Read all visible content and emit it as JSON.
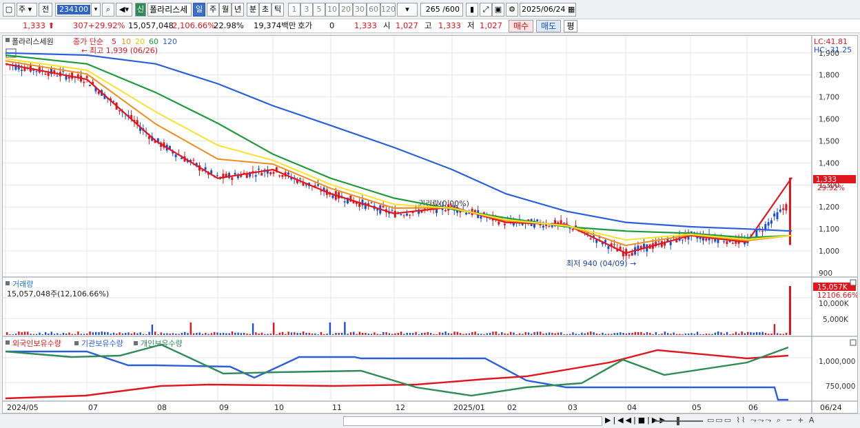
{
  "toolbar": {
    "type_select": "주",
    "prev_label": "전",
    "stock_code": "234100",
    "new_label": "신",
    "stock_name": "폴라리스세",
    "period_tabs": [
      "일",
      "주",
      "월",
      "년",
      "분",
      "초",
      "틱"
    ],
    "active_period": "일",
    "interval_btns": [
      "1",
      "3",
      "5",
      "10",
      "20",
      "30",
      "60",
      "120"
    ],
    "count": "265 /600",
    "date": "2025/06/24"
  },
  "quote": {
    "price": "1,333",
    "change": "307",
    "change_pct": "+29.92%",
    "volume": "15,057,048",
    "volume_ratio": "2,106.66%",
    "turnover": "22.98%",
    "amount": "19,374백만",
    "bid_label": "호가",
    "bid_value": "0",
    "bid_price": "1,333",
    "open_label": "시",
    "open_value": "1,027",
    "high_label": "고",
    "high_value": "1,333",
    "low_label": "저",
    "low_value": "1,027",
    "buy_label": "매수",
    "sell_label": "매도",
    "eval_label": "평"
  },
  "price_panel": {
    "stock_label": "폴라리스세원",
    "ma_label": "종가 단순",
    "ma_periods": [
      "5",
      "10",
      "20",
      "60",
      "120"
    ],
    "ma_colors": [
      "#e0161e",
      "#f08c1e",
      "#f5e42a",
      "#1f9a3c",
      "#2b5fd9"
    ],
    "high_note": "최고 1,939 (06/26)",
    "low_note": "최저 940 (04/09)",
    "ex_right_note": "권리락(0.00%)",
    "lc": "LC:41.81",
    "hc": "HC:-31.25",
    "current_price_tag": "1,333",
    "current_pct_tag": "29.92%",
    "y_ticks": [
      "1,900",
      "1,800",
      "1,700",
      "1,600",
      "1,500",
      "1,400",
      "1,300",
      "1,200",
      "1,100",
      "1,000",
      "900"
    ]
  },
  "volume_panel": {
    "title": "거래량",
    "value_text": "15,057,048주(12,106.66%)",
    "tag_value": "15,057K",
    "tag_pct": "12106.66%",
    "y_ticks": [
      "10,000K",
      "5,000K"
    ]
  },
  "holding_panel": {
    "legend": [
      "외국인보유수량",
      "기관보유수량",
      "개인보유수량"
    ],
    "legend_colors": [
      "#e0161e",
      "#2b5fd9",
      "#2e8b57"
    ],
    "y_ticks": [
      "1,000,000",
      "750,000"
    ]
  },
  "x_axis": {
    "labels": [
      "2024/05",
      "07",
      "08",
      "09",
      "10",
      "11",
      "12",
      "2025/01",
      "02",
      "03",
      "04",
      "05",
      "06",
      "06/24"
    ]
  },
  "chart_data": {
    "type": "line",
    "x": [
      "2024/05",
      "07",
      "08",
      "09",
      "10",
      "11",
      "12",
      "2025/01",
      "02",
      "03",
      "04",
      "05",
      "06",
      "06/24"
    ],
    "series": [
      {
        "name": "5",
        "values": [
          1850,
          1780,
          1500,
          1330,
          1370,
          1260,
          1170,
          1200,
          1130,
          1120,
          990,
          1070,
          1040,
          1333
        ]
      },
      {
        "name": "60",
        "values": [
          1890,
          1850,
          1720,
          1580,
          1440,
          1330,
          1240,
          1190,
          1150,
          1110,
          1090,
          1080,
          1060,
          1070
        ]
      },
      {
        "name": "120",
        "values": [
          1900,
          1890,
          1850,
          1760,
          1660,
          1570,
          1470,
          1370,
          1260,
          1180,
          1130,
          1110,
          1100,
          1090
        ]
      }
    ],
    "ylim": [
      900,
      1940
    ]
  }
}
